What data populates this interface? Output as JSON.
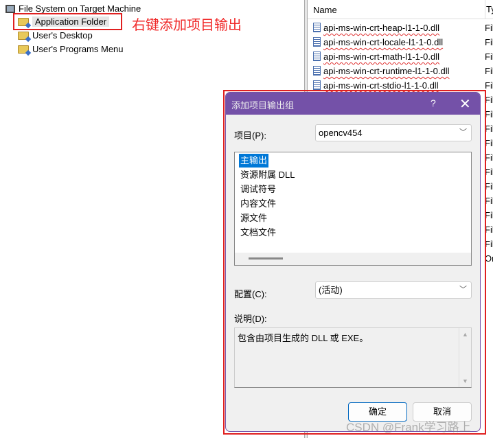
{
  "tree": {
    "root": "File System on Target Machine",
    "items": [
      "Application Folder",
      "User's Desktop",
      "User's Programs Menu"
    ],
    "selected": "Application Folder"
  },
  "annotation": "右键添加项目输出",
  "files": {
    "headers": {
      "name": "Name",
      "type": "Ty"
    },
    "names": [
      "api-ms-win-crt-heap-l1-1-0.dll",
      "api-ms-win-crt-locale-l1-1-0.dll",
      "api-ms-win-crt-math-l1-1-0.dll",
      "api-ms-win-crt-runtime-l1-1-0.dll",
      "api-ms-win-crt-stdio-l1-1-0.dll"
    ],
    "types": [
      "Fil",
      "Fil",
      "Fil",
      "Fil",
      "Fil",
      "Fil",
      "Fil",
      "Fil",
      "Fil",
      "Fil",
      "Fil",
      "Fil",
      "Fil",
      "Fil",
      "Fil",
      "Fil",
      "Or"
    ]
  },
  "dialog": {
    "title": "添加项目输出组",
    "help": "?",
    "close": "✕",
    "project_label": "项目(P):",
    "project_value": "opencv454",
    "outputs": [
      "主输出",
      "资源附属 DLL",
      "调试符号",
      "内容文件",
      "源文件",
      "文档文件"
    ],
    "selected_output": "主输出",
    "config_label": "配置(C):",
    "config_value": "(活动)",
    "desc_label": "说明(D):",
    "desc_text": "包含由项目生成的 DLL 或 EXE。",
    "ok": "确定",
    "cancel": "取消"
  },
  "watermark": "CSDN @Frank学习路上",
  "colors": {
    "titlebar": "#7451a8",
    "selection": "#0078d7",
    "annotation": "#e02020"
  }
}
